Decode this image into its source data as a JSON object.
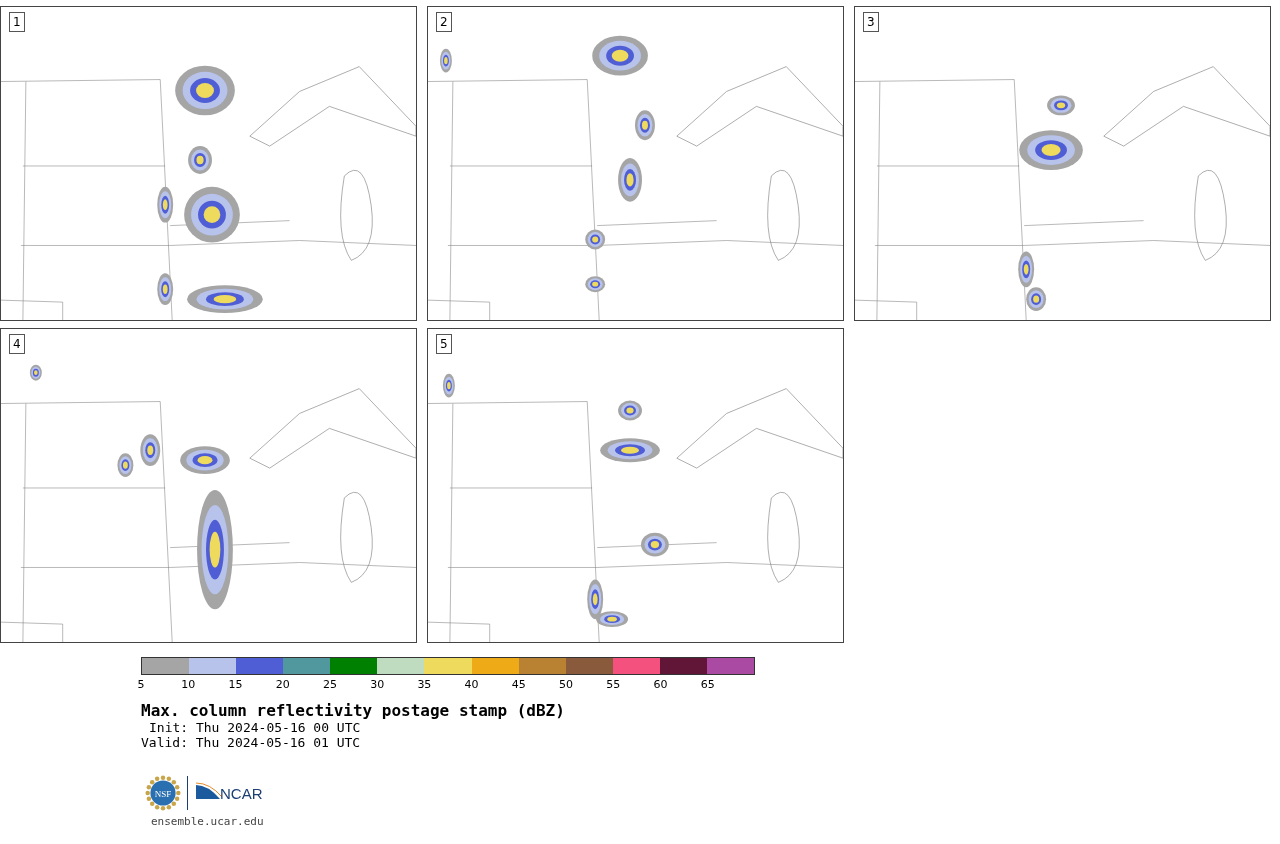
{
  "panels": [
    {
      "label": "1"
    },
    {
      "label": "2"
    },
    {
      "label": "3"
    },
    {
      "label": "4"
    },
    {
      "label": "5"
    }
  ],
  "colorbar": {
    "bins": [
      {
        "color": "#a5a5a5"
      },
      {
        "color": "#b8c3ec"
      },
      {
        "color": "#505ed6"
      },
      {
        "color": "#50979e"
      },
      {
        "color": "#008000"
      },
      {
        "color": "#c0dcc0"
      },
      {
        "color": "#eedb5e"
      },
      {
        "color": "#eeab17"
      },
      {
        "color": "#b98232"
      },
      {
        "color": "#8a5a3d"
      },
      {
        "color": "#f4517e"
      },
      {
        "color": "#611637"
      },
      {
        "color": "#ab4aa3"
      }
    ],
    "ticks": [
      "5",
      "10",
      "15",
      "20",
      "25",
      "30",
      "35",
      "40",
      "45",
      "50",
      "55",
      "60",
      "65"
    ]
  },
  "title": "Max. column reflectivity postage stamp (dBZ)",
  "init": "Init: Thu 2024-05-16 00 UTC",
  "valid": "Valid: Thu 2024-05-16 01 UTC",
  "logos": {
    "nsf": "NSF",
    "ncar": "NCAR"
  },
  "footer": "ensemble.ucar.edu"
}
